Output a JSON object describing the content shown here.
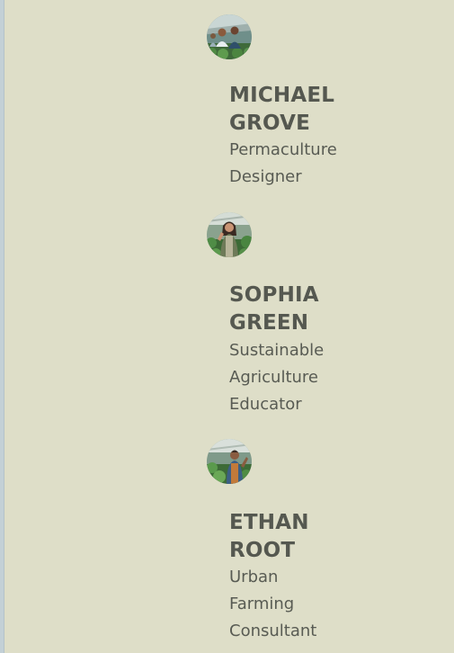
{
  "team": {
    "members": [
      {
        "avatar_icon": "farmers-in-greenhouse-photo-icon",
        "name": "MICHAEL GROVE",
        "role": "Permaculture Designer"
      },
      {
        "avatar_icon": "woman-in-greenhouse-photo-icon",
        "name": "SOPHIA GREEN",
        "role": "Sustainable Agriculture Educator"
      },
      {
        "avatar_icon": "man-with-vegetables-photo-icon",
        "name": "ETHAN ROOT",
        "role": "Urban Farming Consultant"
      }
    ]
  },
  "colors": {
    "background": "#dedec8",
    "text_heading": "#555850",
    "text_body": "#585b53",
    "left_edge": "#c3d0d6"
  }
}
